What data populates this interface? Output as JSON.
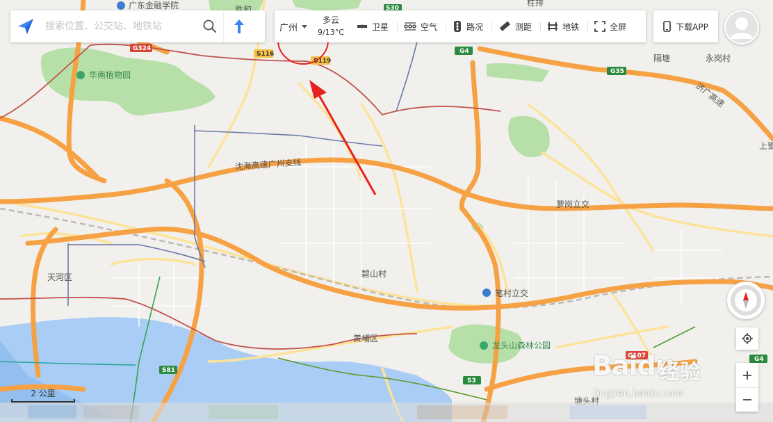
{
  "search": {
    "placeholder": "搜索位置、公交站、地铁站"
  },
  "toolbar": {
    "city": "广州",
    "weather_condition": "多云",
    "weather_temp": "9/13°C",
    "items": [
      {
        "label": "卫星",
        "icon": "satellite-icon"
      },
      {
        "label": "空气",
        "icon": "air-quality-icon"
      },
      {
        "label": "路况",
        "icon": "traffic-light-icon"
      },
      {
        "label": "测距",
        "icon": "ruler-icon"
      },
      {
        "label": "地铁",
        "icon": "subway-icon"
      },
      {
        "label": "全屏",
        "icon": "fullscreen-icon"
      }
    ],
    "download_app": "下载APP"
  },
  "map": {
    "places": {
      "finance_college": "广东金融学院",
      "botanical_garden": "华南植物园",
      "tianhe": "天河区",
      "huangpu": "黄埔区",
      "bishan": "碧山村",
      "luogang_interchange": "萝岗立交",
      "bicun_interchange": "笔村立交",
      "longtoushan": "龙头山森林公园",
      "geshan": "隔塘",
      "yonggang": "永岗村",
      "tangtou": "塘头村",
      "shangjing": "上鄧",
      "shenghe": "胜和",
      "zhaipai": "柱排"
    },
    "highways": {
      "shenhai": "沈海高速广州支线",
      "jiguang": "济广高速"
    },
    "shields": {
      "g324": "G324",
      "s116": "S116",
      "s119": "S119",
      "g4_top": "G4",
      "g35": "G35",
      "s81": "S81",
      "s3": "S3",
      "g107": "G107",
      "g4_right": "G4",
      "top_center": "S30"
    },
    "scale": "2 公里",
    "colors": {
      "land": "#f1f0ed",
      "water": "#a9cdf4",
      "park": "#b7e0a9",
      "highway": "#f6a244",
      "secondary_road": "#fde39a",
      "annotation": "#e8201e"
    }
  },
  "watermark": {
    "brand": "Baidu",
    "sub": "经验",
    "url": "jingyan.baidu.com"
  }
}
